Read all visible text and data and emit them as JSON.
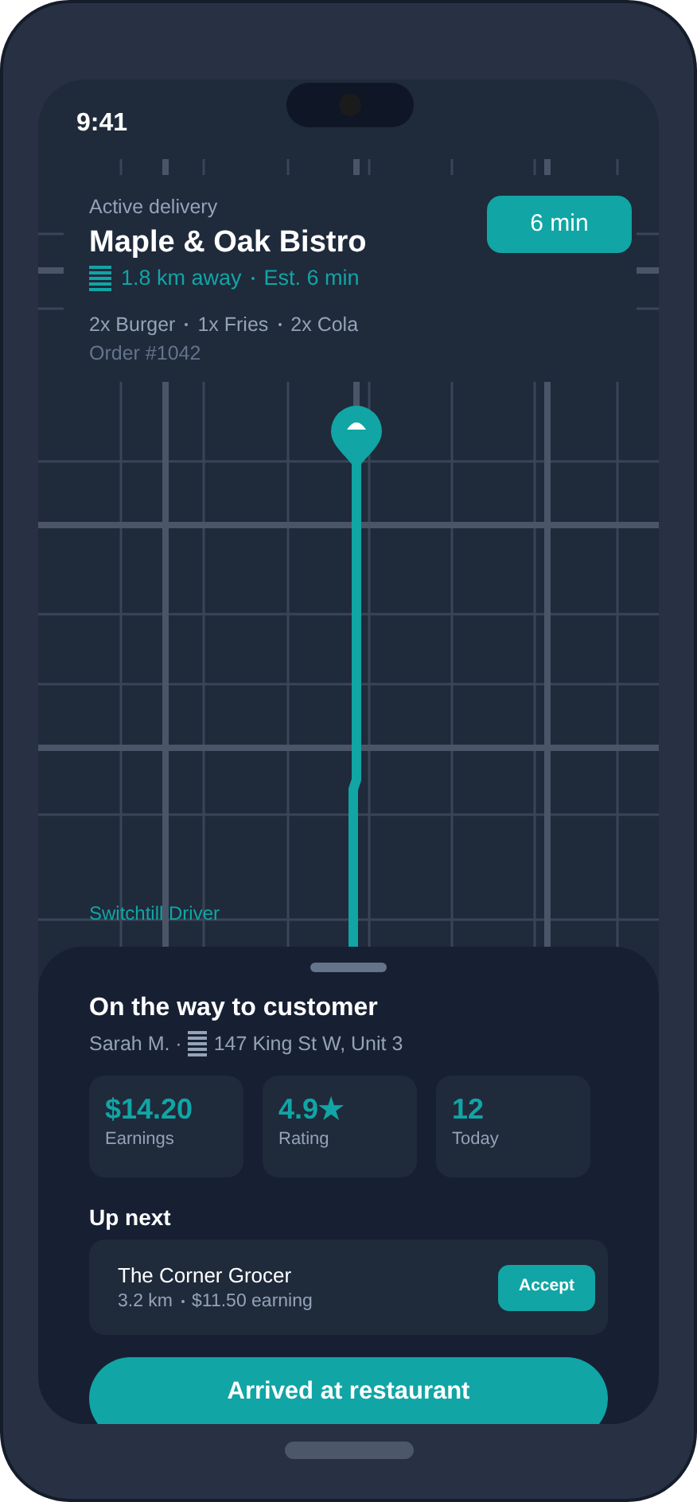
{
  "status_bar": {
    "time": "9:41"
  },
  "delivery": {
    "label": "Active delivery",
    "restaurant": "Maple & Oak Bistro",
    "distance": "1.8 km away",
    "eta": "Est. 6 min",
    "items": [
      "2x Burger",
      "1x Fries",
      "2x Cola"
    ],
    "order": "Order #1042",
    "eta_badge": "6 min"
  },
  "map": {
    "label": "Switchtill Driver"
  },
  "sheet": {
    "title": "On the way to customer",
    "customer": "Sarah M. ·",
    "address": "147 King St W, Unit 3",
    "stats": [
      {
        "value": "$14.20",
        "label": "Earnings"
      },
      {
        "value": "4.9★",
        "label": "Rating"
      },
      {
        "value": "12",
        "label": "Today"
      }
    ],
    "up_next": {
      "heading": "Up next",
      "name": "The Corner Grocer",
      "distance": "3.2 km",
      "earning": "$11.50 earning",
      "button": "Accept"
    },
    "primary_button": "Arrived at restaurant"
  }
}
